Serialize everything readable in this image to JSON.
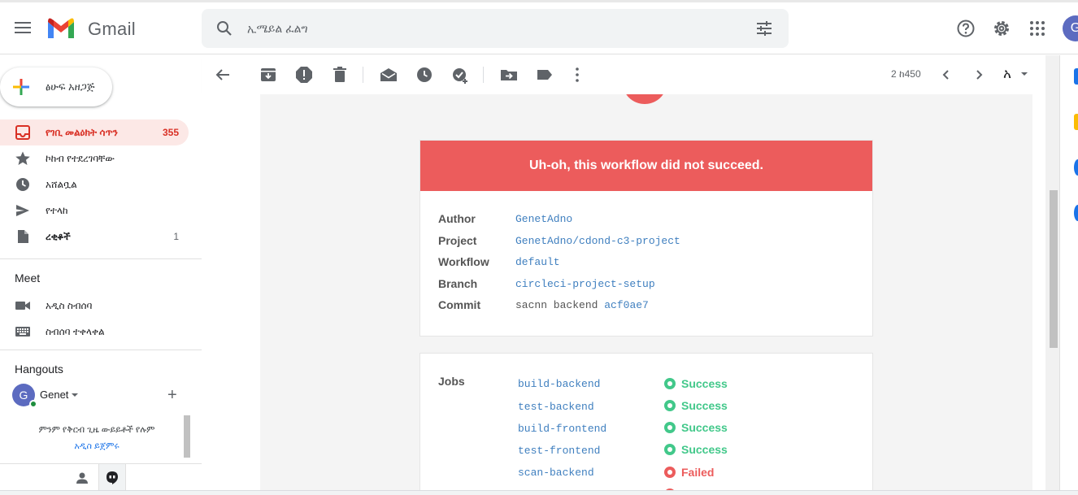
{
  "colors": {
    "accent_red": "#d93025",
    "banner_red": "#ec5c5c",
    "success_green": "#42c88a",
    "link_blue": "#3f7fbf"
  },
  "header": {
    "app_name": "Gmail",
    "search_placeholder": "ኢሜይል ፈልግ",
    "avatar_letter": "G",
    "icons": [
      "menu-icon",
      "search-icon",
      "search-options-icon",
      "help-icon",
      "settings-icon",
      "apps-icon"
    ]
  },
  "sidebar": {
    "compose_label": "ፅሁፍ አዘጋጅ",
    "items": [
      {
        "label": "የገቢ መልዕክት ሳጥን",
        "count": "355",
        "icon": "inbox-icon",
        "active": true
      },
      {
        "label": "ኮከብ የተደረገባቸው",
        "count": "",
        "icon": "star-icon"
      },
      {
        "label": "አሸልቧል",
        "count": "",
        "icon": "clock-icon"
      },
      {
        "label": "የተላከ",
        "count": "",
        "icon": "send-icon"
      },
      {
        "label": "ረቂቆች",
        "count": "1",
        "icon": "draft-icon"
      }
    ],
    "meet": {
      "title": "Meet",
      "items": [
        {
          "label": "አዲስ ስብሰባ",
          "icon": "video-icon"
        },
        {
          "label": "ስብሰባ ተቀላቀል",
          "icon": "keyboard-icon"
        }
      ]
    },
    "hangouts": {
      "title": "Hangouts",
      "user": "Genet",
      "avatar_letter": "G",
      "empty_message": "ምንም የቅርብ ጊዜ ውይይቶች የሉም",
      "start_link": "አዲስ ይጀምሩ"
    }
  },
  "toolbar": {
    "icons": [
      "back-icon",
      "archive-icon",
      "report-spam-icon",
      "delete-icon",
      "mark-unread-icon",
      "snooze-icon",
      "add-task-icon",
      "move-to-icon",
      "label-icon",
      "more-icon"
    ],
    "pager": "2 ከ450",
    "input_tool": "አ"
  },
  "email": {
    "banner": "Uh-oh, this workflow did not succeed.",
    "details": [
      {
        "label": "Author",
        "value": "GenetAdno"
      },
      {
        "label": "Project",
        "value": "GenetAdno/cdond-c3-project"
      },
      {
        "label": "Workflow",
        "value": "default"
      },
      {
        "label": "Branch",
        "value": "circleci-project-setup"
      },
      {
        "label": "Commit",
        "value_prefix": "sacnn backend",
        "value": "acf0ae7"
      }
    ],
    "jobs_label": "Jobs",
    "jobs": [
      {
        "name": "build-backend",
        "status": "Success"
      },
      {
        "name": "test-backend",
        "status": "Success"
      },
      {
        "name": "build-frontend",
        "status": "Success"
      },
      {
        "name": "test-frontend",
        "status": "Success"
      },
      {
        "name": "scan-backend",
        "status": "Failed"
      }
    ]
  }
}
